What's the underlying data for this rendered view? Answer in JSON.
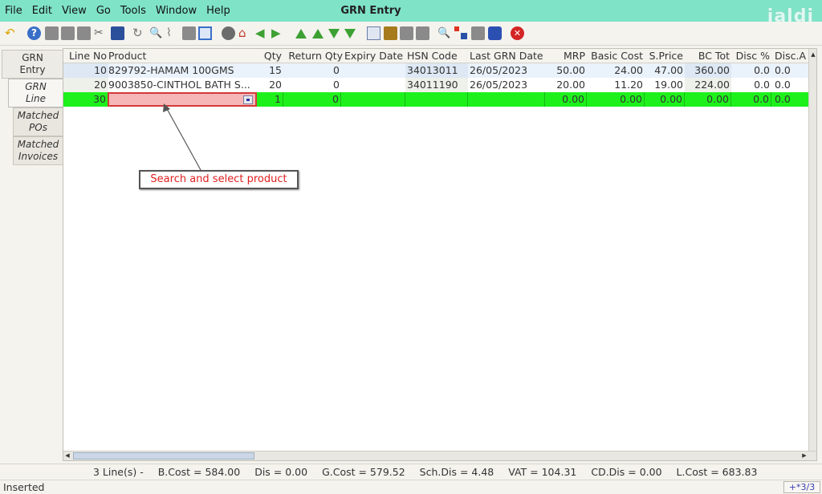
{
  "window": {
    "title": "GRN Entry",
    "logo_text": "jaldi"
  },
  "menu": [
    "File",
    "Edit",
    "View",
    "Go",
    "Tools",
    "Window",
    "Help"
  ],
  "side_tabs": [
    {
      "line1": "GRN",
      "line2": "Entry"
    },
    {
      "line1": "GRN",
      "line2": "Line"
    },
    {
      "line1": "Matched",
      "line2": "POs"
    },
    {
      "line1": "Matched",
      "line2": "Invoices"
    }
  ],
  "columns": [
    "Line No",
    "Product",
    "Qty",
    "Return Qty",
    "Expiry Date",
    "HSN Code",
    "Last GRN Date",
    "MRP",
    "Basic Cost",
    "S.Price",
    "BC Tot",
    "Disc %",
    "Disc.A"
  ],
  "rows": [
    {
      "line_no": "10",
      "product": "829792-HAMAM 100GMS",
      "qty": "15",
      "return_qty": "0",
      "expiry": "",
      "hsn": "34013011",
      "last_grn": "26/05/2023",
      "mrp": "50.00",
      "basic_cost": "24.00",
      "sprice": "47.00",
      "bc_tot": "360.00",
      "disc_pct": "0.0",
      "disc_a": "0.0"
    },
    {
      "line_no": "20",
      "product": "9003850-CINTHOL BATH S...",
      "qty": "20",
      "return_qty": "0",
      "expiry": "",
      "hsn": "34011190",
      "last_grn": "26/05/2023",
      "mrp": "20.00",
      "basic_cost": "11.20",
      "sprice": "19.00",
      "bc_tot": "224.00",
      "disc_pct": "0.0",
      "disc_a": "0.0"
    },
    {
      "line_no": "30",
      "product": "",
      "qty": "1",
      "return_qty": "0",
      "expiry": "",
      "hsn": "",
      "last_grn": "",
      "mrp": "0.00",
      "basic_cost": "0.00",
      "sprice": "0.00",
      "bc_tot": "0.00",
      "disc_pct": "0.0",
      "disc_a": "0.0"
    }
  ],
  "annotation": {
    "text": "Search and select product",
    "color": "#e02020"
  },
  "summary": {
    "lines": "3 Line(s) -",
    "bcost": "B.Cost = 584.00",
    "dis": "Dis = 0.00",
    "gcost": "G.Cost = 579.52",
    "schdis": "Sch.Dis = 4.48",
    "vat": "VAT = 104.31",
    "cddis": "CD.Dis = 0.00",
    "lcost": "L.Cost = 683.83"
  },
  "status": {
    "text": "Inserted",
    "position": "+*3/3"
  },
  "colors": {
    "menubar": "#7fe3c8",
    "active_row": "#1ef01c",
    "product_input": "#f6b6b8"
  }
}
